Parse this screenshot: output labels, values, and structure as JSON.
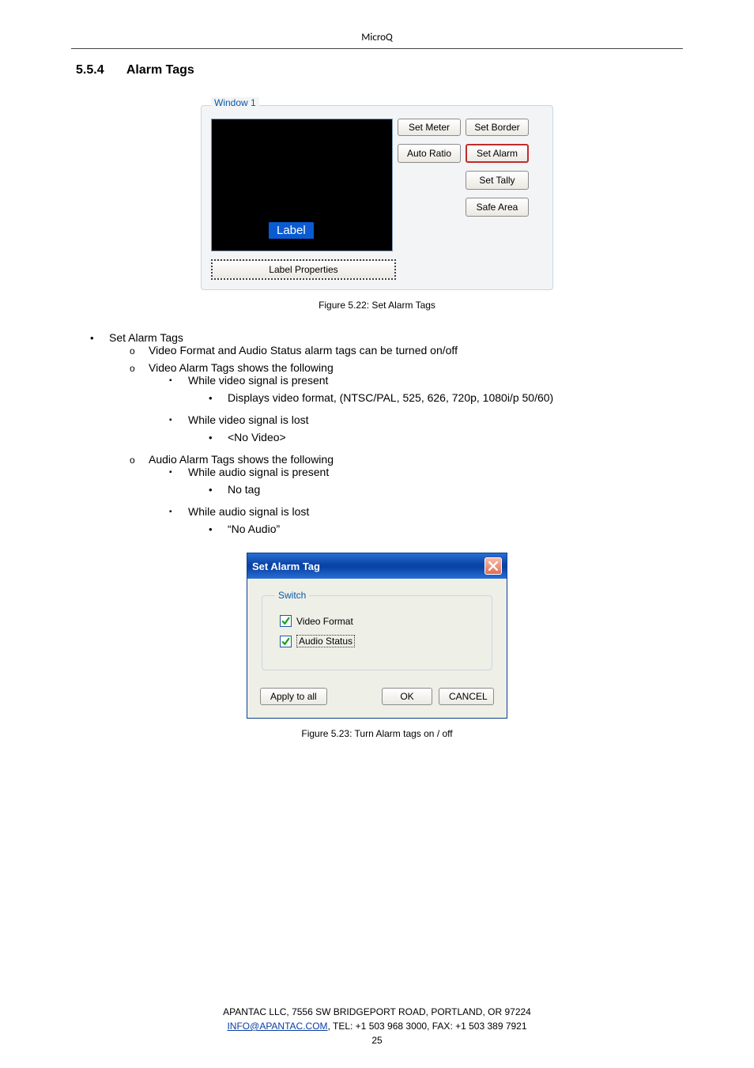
{
  "header": {
    "app_name": "MicroQ"
  },
  "section": {
    "number": "5.5.4",
    "title": "Alarm Tags"
  },
  "window1": {
    "legend": "Window 1",
    "preview_label": "Label",
    "buttons": {
      "set_meter": "Set Meter",
      "set_border": "Set Border",
      "auto_ratio": "Auto Ratio",
      "set_alarm": "Set Alarm",
      "set_tally": "Set Tally",
      "safe_area": "Safe Area"
    },
    "label_properties": "Label Properties"
  },
  "fig1": {
    "caption": "Figure 5.22:    Set Alarm Tags"
  },
  "bullets": {
    "root": "Set Alarm Tags",
    "a": "Video Format and Audio Status alarm tags can be turned on/off",
    "b": "Video Alarm Tags shows the following",
    "b1": "While video signal is present",
    "b1a": "Displays video format, (NTSC/PAL, 525, 626, 720p, 1080i/p 50/60)",
    "b2": "While video signal is lost",
    "b2a": "<No Video>",
    "c": "Audio Alarm Tags shows the following",
    "c1": "While audio signal is present",
    "c1a": "No tag",
    "c2": "While audio signal is lost",
    "c2a": "“No Audio”"
  },
  "dialog": {
    "title": "Set Alarm Tag",
    "switch_legend": "Switch",
    "video_format": "Video Format",
    "audio_status": "Audio Status",
    "apply_all": "Apply to all",
    "ok": "OK",
    "cancel": "CANCEL"
  },
  "fig2": {
    "caption": "Figure 5.23:    Turn Alarm tags on / off"
  },
  "footer": {
    "line1": "APANTAC LLC, 7556 SW BRIDGEPORT ROAD, PORTLAND, OR 97224",
    "email": "INFO@APANTAC.COM",
    "line2_rest": ", TEL:    +1 503 968 3000, FAX:    +1 503 389 7921",
    "page": "25"
  }
}
